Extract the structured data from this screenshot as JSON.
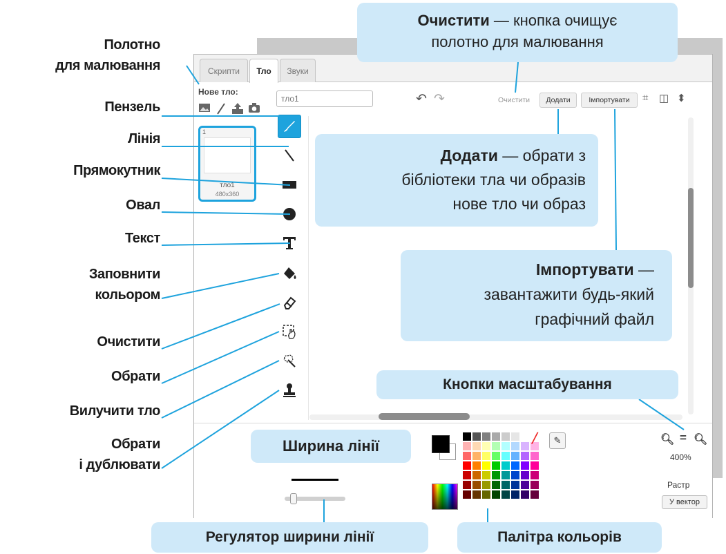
{
  "editor": {
    "tabs": [
      {
        "label": "Скрипти",
        "active": false
      },
      {
        "label": "Тло",
        "active": true
      },
      {
        "label": "Звуки",
        "active": false
      }
    ],
    "new_backdrop_label": "Нове тло:",
    "new_backdrop_icons": [
      "image-icon",
      "paint-icon",
      "upload-icon",
      "camera-icon"
    ],
    "thumbnail": {
      "number": "1",
      "name": "тло1",
      "size": "480x360"
    },
    "name_field_value": "тло1",
    "toolbar": {
      "clear_label": "Очистити",
      "add_label": "Додати",
      "import_label": "Імпортувати"
    },
    "tools": [
      {
        "name": "brush-tool",
        "icon": "brush-icon",
        "active": true
      },
      {
        "name": "line-tool",
        "icon": "line-icon",
        "active": false
      },
      {
        "name": "rectangle-tool",
        "icon": "rectangle-icon",
        "active": false
      },
      {
        "name": "ellipse-tool",
        "icon": "ellipse-icon",
        "active": false
      },
      {
        "name": "text-tool",
        "icon": "text-icon",
        "active": false
      },
      {
        "name": "fill-tool",
        "icon": "bucket-icon",
        "active": false
      },
      {
        "name": "eraser-tool",
        "icon": "eraser-icon",
        "active": false
      },
      {
        "name": "select-tool",
        "icon": "select-icon",
        "active": false
      },
      {
        "name": "remove-background-tool",
        "icon": "wand-icon",
        "active": false
      },
      {
        "name": "stamp-tool",
        "icon": "stamp-icon",
        "active": false
      }
    ],
    "zoom": {
      "level": "400%"
    },
    "modes": {
      "bitmap": "Растр",
      "vector": "У вектор"
    },
    "colors": {
      "accent": "#1ea3dd",
      "callout": "#cfe9f9",
      "leader_line": "#1ea3dd"
    }
  },
  "labels": [
    {
      "name": "label-canvas",
      "lines": [
        "Полотно",
        "для малювання"
      ]
    },
    {
      "name": "label-brush",
      "lines": [
        "Пензель"
      ]
    },
    {
      "name": "label-line",
      "lines": [
        "Лінія"
      ]
    },
    {
      "name": "label-rectangle",
      "lines": [
        "Прямокутник"
      ]
    },
    {
      "name": "label-oval",
      "lines": [
        "Овал"
      ]
    },
    {
      "name": "label-text",
      "lines": [
        "Текст"
      ]
    },
    {
      "name": "label-fill",
      "lines": [
        "Заповнити",
        "кольором"
      ]
    },
    {
      "name": "label-eraser",
      "lines": [
        "Очистити"
      ]
    },
    {
      "name": "label-select",
      "lines": [
        "Обрати"
      ]
    },
    {
      "name": "label-remove-bg",
      "lines": [
        "Вилучити тло"
      ]
    },
    {
      "name": "label-select-duplicate",
      "lines": [
        "Обрати",
        "і дублювати"
      ]
    }
  ],
  "callouts": {
    "clear": {
      "title": "Очистити",
      "rest1": " — кнопка очищує",
      "rest2": "полотно для малювання"
    },
    "add": {
      "title": "Додати",
      "rest1": " — обрати з",
      "rest2": "бібліотеки тла чи образів",
      "rest3": "нове тло чи образ"
    },
    "import": {
      "title": "Імпортувати",
      "rest1": " —",
      "rest2": "завантажити будь-який",
      "rest3": "графічний файл"
    },
    "zoom": "Кнопки масштабування",
    "line_width": "Ширина лінії",
    "width_slider": "Регулятор ширини лінії",
    "palette": "Палітра кольорів"
  }
}
